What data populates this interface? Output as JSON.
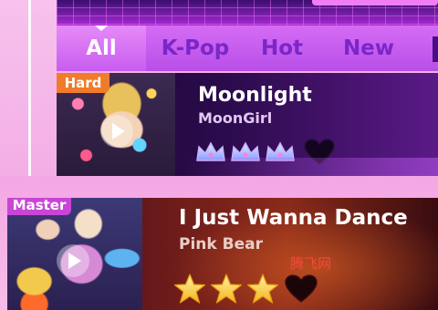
{
  "tabs": [
    {
      "label": "All",
      "active": true
    },
    {
      "label": "K-Pop",
      "active": false
    },
    {
      "label": "Hot",
      "active": false
    },
    {
      "label": "New",
      "active": false
    }
  ],
  "songs": [
    {
      "title": "Moonlight",
      "artist": "MoonGirl",
      "difficulty": "Hard",
      "rating_icon": "crown-icon",
      "rating": 3,
      "favorite": false
    },
    {
      "title": "I Just Wanna Dance",
      "artist": "Pink Bear",
      "difficulty": "Master",
      "rating_icon": "star-icon",
      "rating": 3,
      "favorite": false
    }
  ],
  "watermark": "腾飞网",
  "colors": {
    "tab_active": "#c85df0",
    "badge_hard": "#f07b2a",
    "badge_master": "#c945d6",
    "star": "#f9cf3a",
    "crown": "#a8b8ff"
  }
}
